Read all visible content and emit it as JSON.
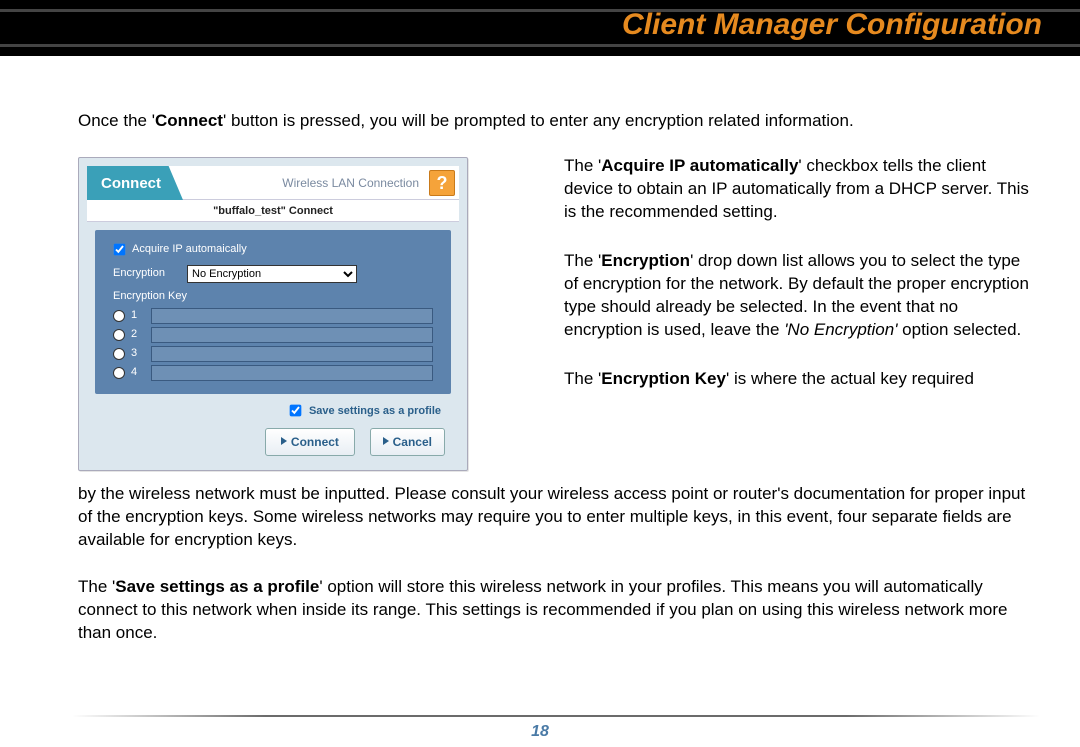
{
  "header": {
    "title": "Client Manager Configuration"
  },
  "page_number": "18",
  "intro": {
    "pre": "Once the '",
    "bold": "Connect",
    "post": "' button is pressed, you will be prompted to enter any encryption related information."
  },
  "para_acquire": {
    "pre": "The '",
    "bold": "Acquire IP automatically",
    "post": "' checkbox tells the client device to obtain an IP automatically from a DHCP server.  This is the recommended setting."
  },
  "para_encryption": {
    "pre": "The '",
    "bold": "Encryption",
    "mid": "' drop down list allows you to select the type of encryption for the network.  By default the proper encryption type should already be selected.  In the event that no encryption is used, leave the ",
    "ital": "'No Encryption'",
    "post": " option selected."
  },
  "para_key_lead": {
    "pre": "The '",
    "bold": "Encryption Key",
    "post": "' is where the actual key required"
  },
  "para_key_body": "by the wireless network must be inputted.  Please consult your wireless access point or router's documentation for proper input of the encryption keys.  Some wireless networks may require you to enter multiple keys, in this event, four separate fields are available for encryption keys.",
  "para_save": {
    "pre": "The '",
    "bold": "Save settings as a profile",
    "post": "' option will store this wireless network in your profiles.  This means you will automatically connect to this network when inside its range.  This settings is recommended if you plan on using this wireless network more than once."
  },
  "dialog": {
    "tab": "Connect",
    "subtitle": "Wireless LAN Connection",
    "help": "?",
    "bar": "\"buffalo_test\"  Connect",
    "acquire_label": "Acquire IP automaically",
    "encryption_label": "Encryption",
    "encryption_selected": "No Encryption",
    "keylabel": "Encryption Key",
    "keys": [
      "1",
      "2",
      "3",
      "4"
    ],
    "save_label": "Save settings as a profile",
    "connect_btn": "Connect",
    "cancel_btn": "Cancel"
  }
}
